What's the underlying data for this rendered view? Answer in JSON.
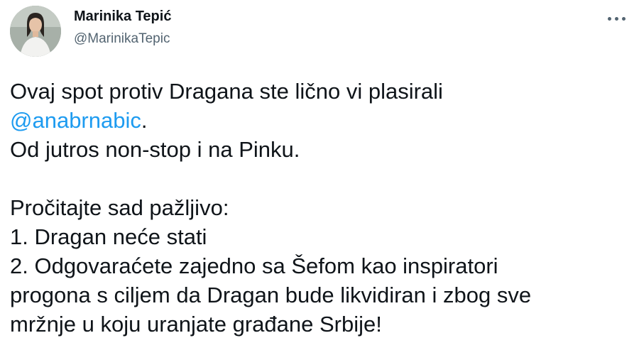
{
  "author": {
    "display_name": "Marinika Tepić",
    "handle": "@MarinikaTepic"
  },
  "tweet": {
    "line1": "Ovaj spot protiv Dragana ste lično vi plasirali",
    "mention": "@anabrnabic",
    "mention_suffix": ".",
    "line3": "Od jutros non-stop i na Pinku.",
    "line5": "Pročitajte sad pažljivo:",
    "line6": "1. Dragan neće stati",
    "line7": "2. Odgovaraćete zajedno sa Šefom kao inspiratori",
    "line8": "progona s ciljem da Dragan bude likvidiran i zbog sve",
    "line9": "mržnje u koju uranjate građane Srbije!"
  },
  "icons": {
    "more": "more-dots-icon"
  },
  "colors": {
    "text": "#0f1419",
    "secondary": "#536471",
    "link": "#1d9bf0"
  }
}
